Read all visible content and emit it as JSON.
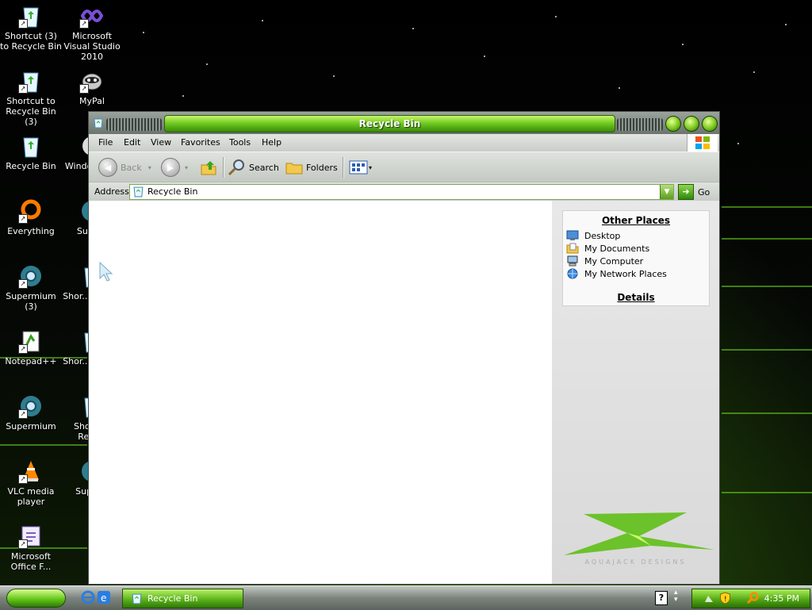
{
  "desktop": {
    "icons": [
      {
        "label": "Shortcut (3) to Recycle Bin",
        "icon": "recycle-bin-icon"
      },
      {
        "label": "Microsoft Visual Studio 2010",
        "icon": "visual-studio-icon"
      },
      {
        "label": "Shortcut to Recycle Bin (3)",
        "icon": "recycle-bin-icon"
      },
      {
        "label": "MyPal",
        "icon": "mypal-icon"
      },
      {
        "label": "Recycle Bin",
        "icon": "recycle-bin-icon"
      },
      {
        "label": "Windo... M...",
        "icon": "windows-media-icon"
      },
      {
        "label": "Everything",
        "icon": "everything-icon"
      },
      {
        "label": "Supe...",
        "icon": "supermium-icon"
      },
      {
        "label": "Supermium (3)",
        "icon": "supermium-icon"
      },
      {
        "label": "Shor... Recy...",
        "icon": "recycle-bin-icon"
      },
      {
        "label": "Notepad++",
        "icon": "notepad-plus-plus-icon"
      },
      {
        "label": "Shor... Recy...",
        "icon": "recycle-bin-icon"
      },
      {
        "label": "Supermium",
        "icon": "supermium-icon"
      },
      {
        "label": "Shortc... Recy...",
        "icon": "recycle-bin-icon"
      },
      {
        "label": "VLC media player",
        "icon": "vlc-icon"
      },
      {
        "label": "Super...",
        "icon": "supermium-icon"
      },
      {
        "label": "Microsoft Office F...",
        "icon": "office-icon"
      }
    ]
  },
  "window": {
    "title": "Recycle Bin",
    "menu": [
      "File",
      "Edit",
      "View",
      "Favorites",
      "Tools",
      "Help"
    ],
    "toolbar": {
      "back": "Back",
      "search": "Search",
      "folders": "Folders"
    },
    "address": {
      "label": "Address",
      "value": "Recycle Bin",
      "go": "Go"
    },
    "task_pane": {
      "other_places_title": "Other Places",
      "other_places": [
        "Desktop",
        "My Documents",
        "My Computer",
        "My Network Places"
      ],
      "details_title": "Details",
      "brand_text": "AQUAJACK DESIGNS"
    }
  },
  "taskbar": {
    "task_button": "Recycle Bin",
    "clock": "4:35 PM",
    "help_glyph": "?"
  },
  "colors": {
    "accent_green": "#6cc81e",
    "window_gray": "#7f8a82"
  }
}
